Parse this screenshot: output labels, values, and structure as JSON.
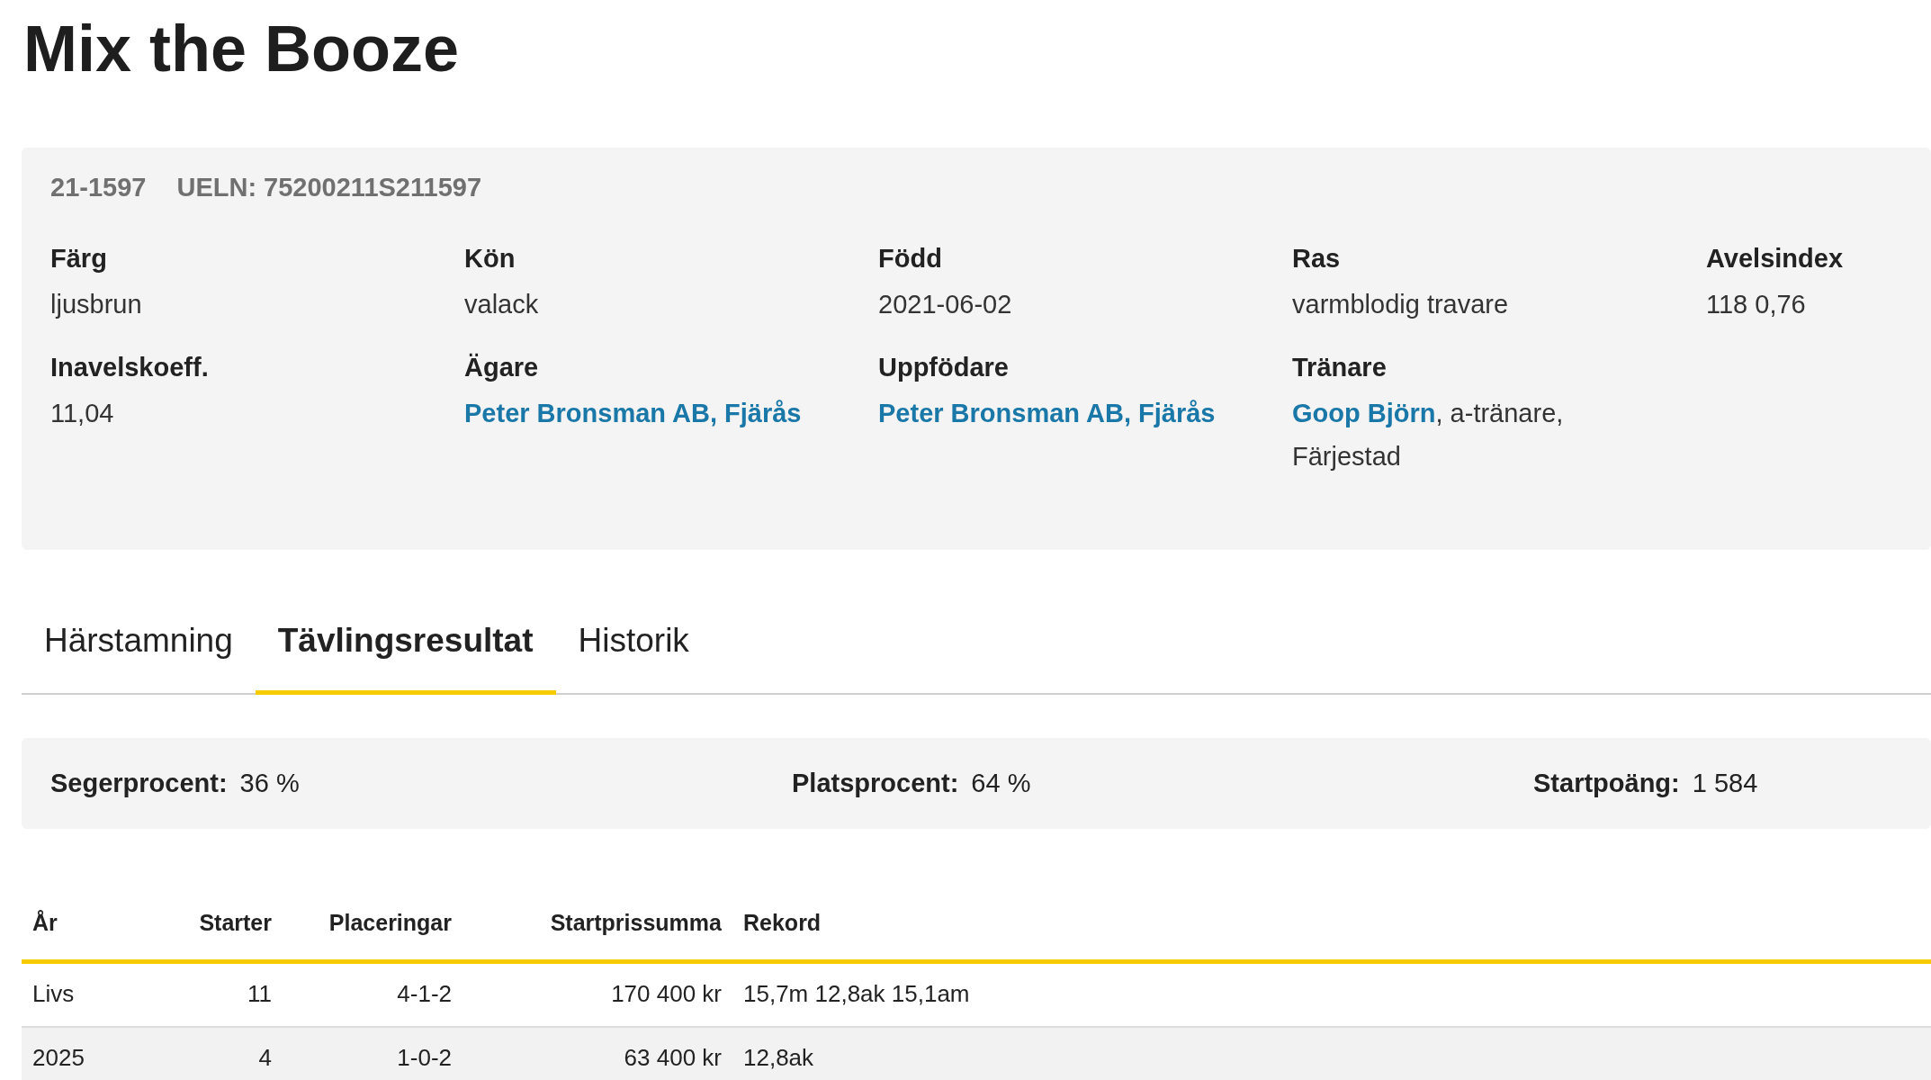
{
  "title": "Mix the Booze",
  "info_card": {
    "ids": [
      "21-1597",
      "UELN: 75200211S211597"
    ],
    "fields": [
      {
        "label": "Färg",
        "parts": [
          {
            "text": "ljusbrun",
            "link": false
          }
        ]
      },
      {
        "label": "Kön",
        "parts": [
          {
            "text": "valack",
            "link": false
          }
        ]
      },
      {
        "label": "Född",
        "parts": [
          {
            "text": "2021-06-02",
            "link": false
          }
        ]
      },
      {
        "label": "Ras",
        "parts": [
          {
            "text": "varmblodig travare",
            "link": false
          }
        ]
      },
      {
        "label": "Avelsindex",
        "parts": [
          {
            "text": "118 0,76",
            "link": false
          }
        ]
      },
      {
        "label": "Inavelskoeff.",
        "parts": [
          {
            "text": "11,04",
            "link": false
          }
        ]
      },
      {
        "label": "Ägare",
        "parts": [
          {
            "text": "Peter Bronsman AB, Fjärås",
            "link": true
          }
        ]
      },
      {
        "label": "Uppfödare",
        "parts": [
          {
            "text": "Peter Bronsman AB, Fjärås",
            "link": true
          }
        ]
      },
      {
        "label": "Tränare",
        "parts": [
          {
            "text": "Goop Björn",
            "link": true
          },
          {
            "text": ", a-tränare, Färjestad",
            "link": false
          }
        ]
      }
    ]
  },
  "tabs": [
    {
      "label": "Härstamning",
      "selected": false
    },
    {
      "label": "Tävlingsresultat",
      "selected": true
    },
    {
      "label": "Historik",
      "selected": false
    }
  ],
  "stats": [
    {
      "label": "Segerprocent:",
      "value": "36 %"
    },
    {
      "label": "Platsprocent:",
      "value": "64 %"
    },
    {
      "label": "Startpoäng:",
      "value": "1 584"
    }
  ],
  "table": {
    "columns": [
      "År",
      "Starter",
      "Placeringar",
      "Startprissumma",
      "Rekord"
    ],
    "rows": [
      [
        "Livs",
        "11",
        "4-1-2",
        "170 400 kr",
        "15,7m 12,8ak 15,1am"
      ],
      [
        "2025",
        "4",
        "1-0-2",
        "63 400 kr",
        "12,8ak"
      ]
    ]
  }
}
